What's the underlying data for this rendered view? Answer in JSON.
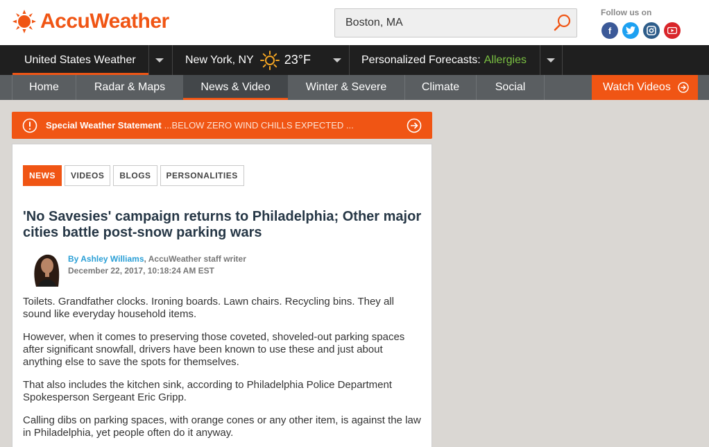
{
  "brand": {
    "name": "AccuWeather",
    "color": "#f05514"
  },
  "search": {
    "value": "Boston, MA",
    "icon": "search-icon"
  },
  "social": {
    "label": "Follow us on",
    "icons": [
      "facebook-icon",
      "twitter-icon",
      "instagram-icon",
      "youtube-icon"
    ]
  },
  "topbar": {
    "region": "United States Weather",
    "city": "New York, NY",
    "temp": "23°F",
    "weather_icon": "sun-icon",
    "personalized_label": "Personalized Forecasts:",
    "personalized_value": "Allergies"
  },
  "nav": {
    "items": [
      "Home",
      "Radar & Maps",
      "News & Video",
      "Winter & Severe",
      "Climate",
      "Social"
    ],
    "active": "News & Video",
    "watch": "Watch Videos"
  },
  "alert": {
    "title": "Special Weather Statement",
    "text": "...BELOW ZERO WIND CHILLS EXPECTED ..."
  },
  "article": {
    "tabs": [
      "NEWS",
      "VIDEOS",
      "BLOGS",
      "PERSONALITIES"
    ],
    "active_tab": "NEWS",
    "headline": "'No Savesies' campaign returns to Philadelphia; Other major cities battle post-snow parking wars",
    "by": "By",
    "author": "Ashley Williams",
    "role": ", AccuWeather staff writer",
    "date": "December 22, 2017, 10:18:24 AM EST",
    "paragraphs": [
      "Toilets. Grandfather clocks. Ironing boards. Lawn chairs. Recycling bins. They all sound like everyday household items.",
      "However, when it comes to preserving those coveted, shoveled-out parking spaces after significant snowfall, drivers have been known to use these and just about anything else to save the spots for themselves.",
      "That also includes the kitchen sink, according to Philadelphia Police Department Spokesperson Sergeant Eric Gripp.",
      "Calling dibs on parking spaces, with orange cones or any other item, is against the law in Philadelphia, yet people often do it anyway."
    ]
  }
}
